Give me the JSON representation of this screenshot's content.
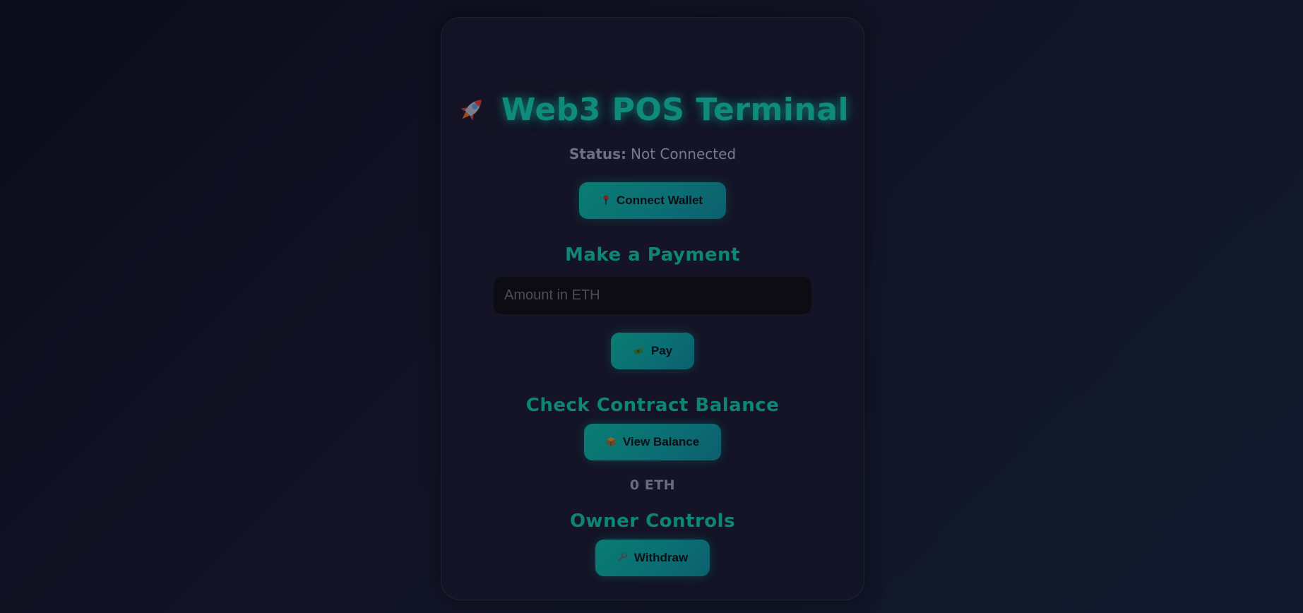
{
  "app": {
    "title": "Web3 POS Terminal",
    "title_icon": "rocket-icon"
  },
  "status": {
    "label": "Status:",
    "value": "Not Connected"
  },
  "wallet": {
    "connect_label": "Connect Wallet",
    "connect_icon": "pin-icon"
  },
  "payment": {
    "heading": "Make a Payment",
    "amount_placeholder": "Amount in ETH",
    "amount_value": "",
    "pay_label": "Pay",
    "pay_icon": "money-icon"
  },
  "balance": {
    "heading": "Check Contract Balance",
    "view_label": "View Balance",
    "view_icon": "box-icon",
    "value": "0 ETH"
  },
  "owner": {
    "heading": "Owner Controls",
    "withdraw_label": "Withdraw",
    "withdraw_icon": "wrench-icon"
  },
  "colors": {
    "accent": "#0d8577",
    "button_gradient_start": "#0a7c72",
    "button_gradient_end": "#0c5f6e",
    "background": "#0f1122",
    "card": "#151428"
  }
}
